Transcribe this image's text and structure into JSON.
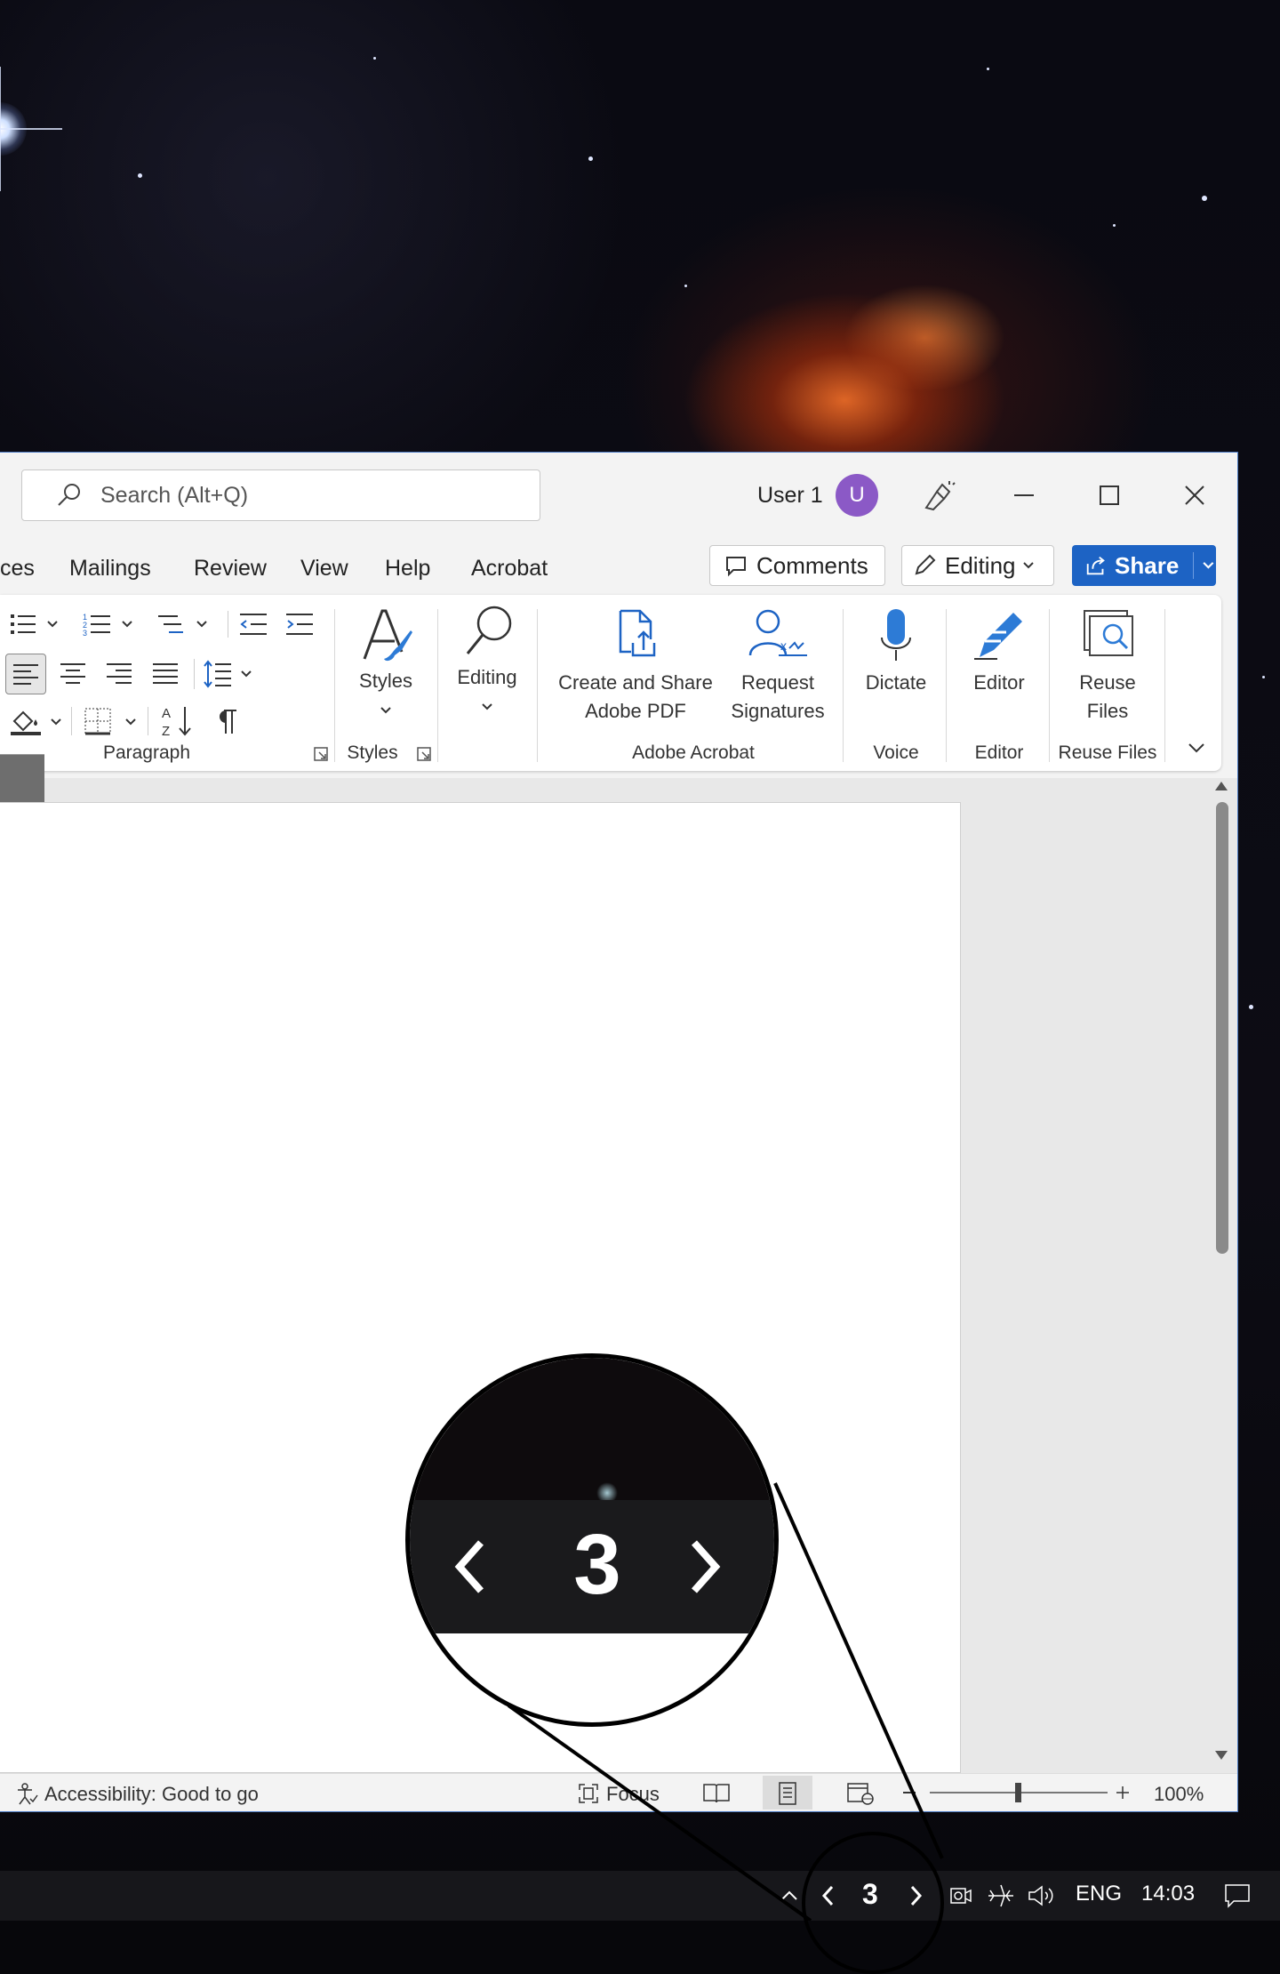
{
  "search": {
    "placeholder": "Search (Alt+Q)"
  },
  "user": {
    "name": "User 1",
    "initial": "U"
  },
  "tabs": [
    "ces",
    "Mailings",
    "Review",
    "View",
    "Help",
    "Acrobat"
  ],
  "buttons": {
    "comments": "Comments",
    "editing": "Editing",
    "share": "Share"
  },
  "ribbon": {
    "styles_label": "Styles",
    "editing_label": "Editing",
    "create_share_label_1": "Create and Share",
    "create_share_label_2": "Adobe PDF",
    "request_sig_label_1": "Request",
    "request_sig_label_2": "Signatures",
    "dictate_label": "Dictate",
    "editor_label": "Editor",
    "reuse_label_1": "Reuse",
    "reuse_label_2": "Files",
    "groups": {
      "paragraph": "Paragraph",
      "styles": "Styles",
      "adobe_acrobat": "Adobe Acrobat",
      "voice": "Voice",
      "editor": "Editor",
      "reuse_files": "Reuse Files"
    }
  },
  "status": {
    "accessibility": "Accessibility: Good to go",
    "focus": "Focus",
    "zoom": "100%"
  },
  "taskbar": {
    "desktop_number": "3",
    "language": "ENG",
    "time": "14:03"
  },
  "magnifier": {
    "number": "3"
  },
  "colors": {
    "accent": "#1d63c4",
    "avatar": "#8b59c6"
  }
}
